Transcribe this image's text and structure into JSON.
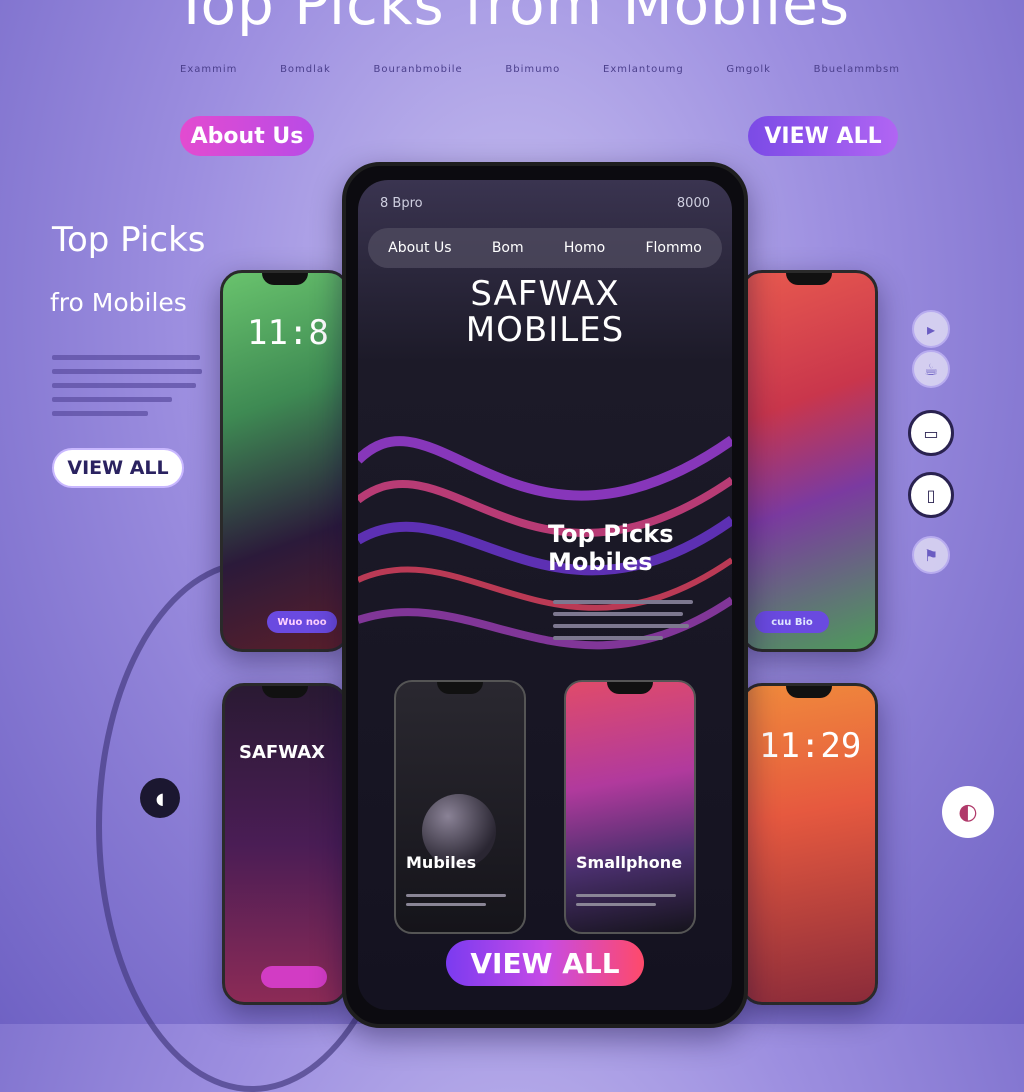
{
  "page": {
    "title": "Top Picks from Mobiles",
    "top_nav": [
      "Exammim",
      "Bomdlak",
      "Bouranbmobile",
      "Bbimumo",
      "Exmlantoumg",
      "Gmgolk",
      "Bbuelammbsm"
    ],
    "about_button": "About Us",
    "view_all_top": "VIEW ALL",
    "left_title": "Top Picks",
    "left_subtitle": "fro Mobiles",
    "view_all_left": "VIEW ALL"
  },
  "main_phone": {
    "status_left": "8 Bpro",
    "status_right": "8000",
    "nav": [
      "About Us",
      "Bom",
      "Homo",
      "Flommo"
    ],
    "brand_line1": "SAFWAX",
    "brand_line2": "MOBILES",
    "heading_line1": "Top Picks",
    "heading_line2": "Mobiles",
    "card_left_label": "Mubiles",
    "card_right_label": "Smallphone",
    "cta": "VIEW ALL"
  },
  "side_phones": {
    "left_top_clock": "11:8",
    "left_top_button": "Wuo noo",
    "left_bottom_brand": "SAFWAX",
    "right_top_button": "cuu Bio",
    "right_bottom_clock": "11:29"
  },
  "colors": {
    "accent_pink": "#e34bd0",
    "accent_violet": "#7b4be6",
    "background": "#9d8fe0"
  },
  "icons": [
    "play-icon",
    "cup-icon",
    "battery-icon",
    "phone-icon",
    "flag-icon",
    "moon-icon"
  ]
}
